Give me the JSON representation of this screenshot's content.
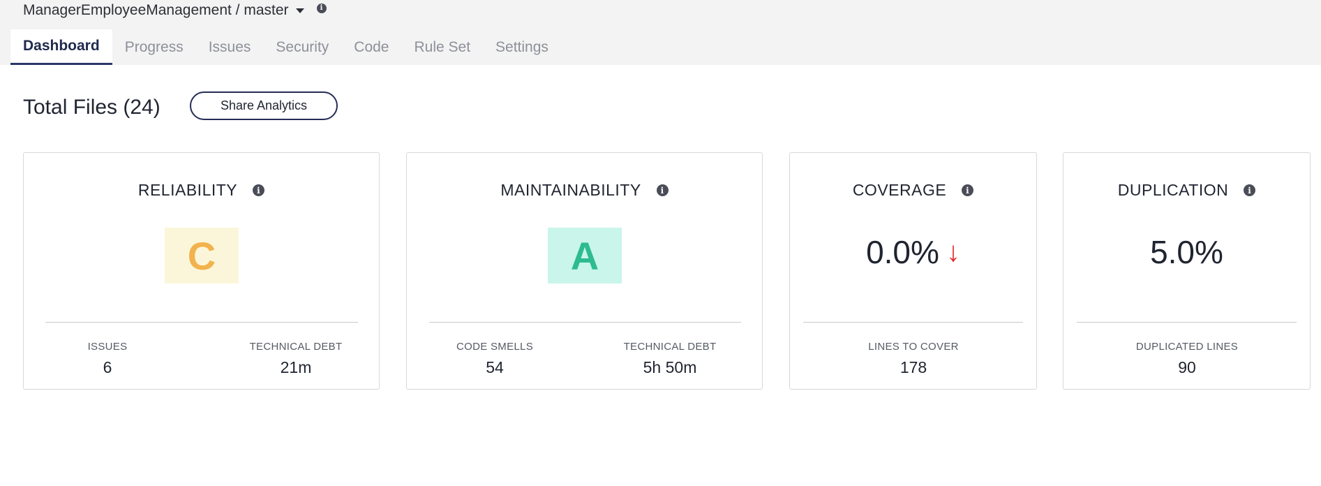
{
  "header": {
    "project_name": "ManagerEmployeeManagement / master",
    "tabs": [
      "Dashboard",
      "Progress",
      "Issues",
      "Security",
      "Code",
      "Rule Set",
      "Settings"
    ],
    "active_tab": "Dashboard"
  },
  "summary": {
    "total_files": "Total Files (24)",
    "share_button": "Share Analytics"
  },
  "cards": {
    "reliability": {
      "title": "RELIABILITY",
      "grade": "C",
      "grade_bg": "#fbf6d9",
      "grade_color": "#f2b24d",
      "metrics": [
        {
          "label": "ISSUES",
          "value": "6"
        },
        {
          "label": "TECHNICAL DEBT",
          "value": "21m"
        }
      ]
    },
    "maintainability": {
      "title": "MAINTAINABILITY",
      "grade": "A",
      "grade_bg": "#c9f5ea",
      "grade_color": "#2dbb8f",
      "metrics": [
        {
          "label": "CODE SMELLS",
          "value": "54"
        },
        {
          "label": "TECHNICAL DEBT",
          "value": "5h 50m"
        }
      ]
    },
    "coverage": {
      "title": "COVERAGE",
      "value": "0.0%",
      "trend_icon": "arrow-down-icon",
      "trend_color": "#e0302d",
      "metrics": [
        {
          "label": "LINES TO COVER",
          "value": "178"
        }
      ]
    },
    "duplication": {
      "title": "DUPLICATION",
      "value": "5.0%",
      "metrics": [
        {
          "label": "DUPLICATED LINES",
          "value": "90"
        }
      ]
    }
  },
  "colors": {
    "accent": "#262c57",
    "info_icon": "#4a4d57"
  }
}
